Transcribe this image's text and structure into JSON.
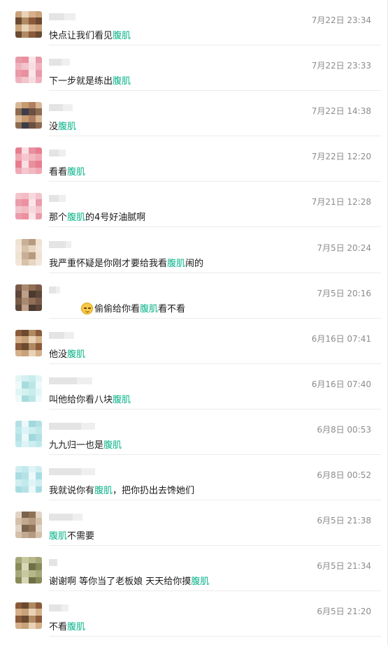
{
  "highlight_color": "#07b389",
  "keyword": "腹肌",
  "comments": [
    {
      "time": "7月22日 23:34",
      "avatar_palette": [
        "#c9a27a",
        "#8a5a3a",
        "#e8d2b8",
        "#6b4a30",
        "#d6b08a",
        "#b08a62"
      ],
      "name_widths": [
        22,
        16
      ],
      "parts": [
        {
          "t": "快点让我们看见"
        },
        {
          "t": "腹肌",
          "hl": true
        }
      ]
    },
    {
      "time": "7月22日 23:33",
      "avatar_palette": [
        "#f2c4cc",
        "#e89aa8",
        "#f7dde2",
        "#ea8fa0",
        "#f0b3be",
        "#f8e6ea"
      ],
      "name_widths": [
        18,
        12
      ],
      "parts": [
        {
          "t": "下一步就是练出"
        },
        {
          "t": "腹肌",
          "hl": true
        }
      ]
    },
    {
      "time": "7月22日 14:38",
      "avatar_palette": [
        "#b08060",
        "#3d3d4a",
        "#d9b898",
        "#6a5040",
        "#c79a70",
        "#8c6a50"
      ],
      "name_widths": [
        20,
        14
      ],
      "parts": [
        {
          "t": "没"
        },
        {
          "t": "腹肌",
          "hl": true
        }
      ]
    },
    {
      "time": "7月22日 12:20",
      "avatar_palette": [
        "#f0a8b4",
        "#e7909e",
        "#f5c6ce",
        "#e87d8f",
        "#f3b7c0",
        "#f9dfe3"
      ],
      "name_widths": [
        14,
        10
      ],
      "parts": [
        {
          "t": "看看"
        },
        {
          "t": "腹肌",
          "hl": true
        }
      ]
    },
    {
      "time": "7月21日 12:28",
      "avatar_palette": [
        "#f2bcc4",
        "#ea9cab",
        "#f7d8dd",
        "#ee8fa0",
        "#f4c4cc",
        "#fae6e9"
      ],
      "name_widths": [
        14,
        10
      ],
      "parts": [
        {
          "t": "那个"
        },
        {
          "t": "腹肌",
          "hl": true
        },
        {
          "t": "的4号好油腻啊"
        }
      ]
    },
    {
      "time": "7月5日 20:24",
      "avatar_palette": [
        "#e6d6c2",
        "#c8b098",
        "#f1e6d8",
        "#b89a80",
        "#d8c2aa",
        "#efe2d2"
      ],
      "name_widths": [
        24,
        8
      ],
      "parts": [
        {
          "t": "我严重怀疑是你刚才要给我看"
        },
        {
          "t": "腹肌",
          "hl": true
        },
        {
          "t": "闹的"
        }
      ]
    },
    {
      "time": "7月5日 20:16",
      "avatar_palette": [
        "#7a5a48",
        "#4a3a30",
        "#a88a70",
        "#5e4638",
        "#926e56",
        "#c0a088"
      ],
      "name_widths": [
        10,
        6
      ],
      "parts": [
        {
          "t": "",
          "emoji": true
        },
        {
          "t": "偷偷给你看"
        },
        {
          "t": "腹肌",
          "hl": true
        },
        {
          "t": "看不看"
        }
      ]
    },
    {
      "time": "6月16日 07:41",
      "avatar_palette": [
        "#c9a27a",
        "#8a5a3a",
        "#e8d2b8",
        "#6b4a30",
        "#d6b08a",
        "#b08a62"
      ],
      "name_widths": [
        22,
        14
      ],
      "parts": [
        {
          "t": "他没"
        },
        {
          "t": "腹肌",
          "hl": true
        }
      ]
    },
    {
      "time": "6月16日 07:40",
      "avatar_palette": [
        "#c8ecec",
        "#a6dcdc",
        "#e2f5f5",
        "#bde6e6",
        "#d4f0f0",
        "#eefafa"
      ],
      "name_widths": [
        40,
        22
      ],
      "parts": [
        {
          "t": "叫他给你看八块"
        },
        {
          "t": "腹肌",
          "hl": true
        }
      ]
    },
    {
      "time": "6月8日 00:53",
      "avatar_palette": [
        "#bfe8ec",
        "#a0d8de",
        "#ddf3f5",
        "#b3e0e4",
        "#cdeef0",
        "#ecf8f9"
      ],
      "name_widths": [
        46,
        20
      ],
      "parts": [
        {
          "t": "九九归一也是"
        },
        {
          "t": "腹肌",
          "hl": true
        }
      ]
    },
    {
      "time": "6月8日 00:52",
      "avatar_palette": [
        "#c2eaee",
        "#a8dce2",
        "#e0f4f6",
        "#b6e2e6",
        "#d0eef1",
        "#eef9fa"
      ],
      "name_widths": [
        46,
        20
      ],
      "parts": [
        {
          "t": "我就说你有"
        },
        {
          "t": "腹肌",
          "hl": true
        },
        {
          "t": "，把你扔出去馋她们"
        }
      ]
    },
    {
      "time": "6月5日 21:38",
      "avatar_palette": [
        "#b49a80",
        "#7a624c",
        "#d4c0aa",
        "#8e7258",
        "#c2a88e",
        "#e2d4c4"
      ],
      "name_widths": [
        34,
        14
      ],
      "parts": [
        {
          "t": "腹肌",
          "hl": true
        },
        {
          "t": "不需要"
        }
      ]
    },
    {
      "time": "6月5日 21:34",
      "avatar_palette": [
        "#a6a87a",
        "#6e7048",
        "#c8c8a0",
        "#888a5a",
        "#b6b88a",
        "#d8d8b8"
      ],
      "name_widths": [
        12,
        0
      ],
      "parts": [
        {
          "t": "谢谢啊  等你当了老板娘  天天给你摸"
        },
        {
          "t": "腹肌",
          "hl": true
        }
      ]
    },
    {
      "time": "6月5日 21:20",
      "avatar_palette": [
        "#c9a27a",
        "#8a5a3a",
        "#e8d2b8",
        "#6b4a30",
        "#d6b08a",
        "#b08a62"
      ],
      "name_widths": [
        18,
        10
      ],
      "parts": [
        {
          "t": "不看"
        },
        {
          "t": "腹肌",
          "hl": true
        }
      ]
    }
  ]
}
